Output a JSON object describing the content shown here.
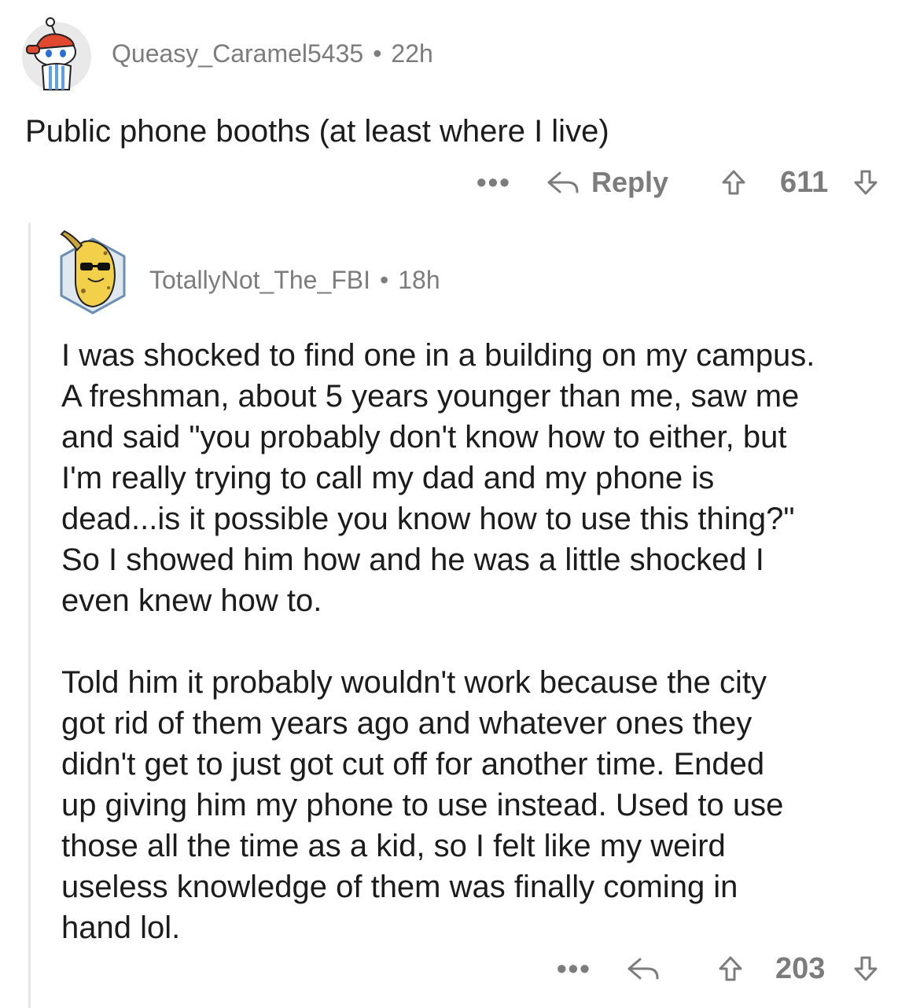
{
  "comment": {
    "username": "Queasy_Caramel5435",
    "separator": "•",
    "age": "22h",
    "text": "Public phone booths (at least where I live)",
    "actions": {
      "more": "•••",
      "reply_label": "Reply",
      "score": "611"
    }
  },
  "reply": {
    "username": "TotallyNot_The_FBI",
    "separator": "•",
    "age": "18h",
    "paragraphs": [
      "I was shocked to find one in a building on my campus.\nA freshman, about 5 years younger than me, saw me\nand said \"you probably don't know how to either, but\nI'm really trying to call my dad and my phone is\ndead...is it possible you know how to use this thing?\"\nSo I showed him how and he was a little shocked I\neven knew how to.",
      "Told him it probably wouldn't work because the city\ngot rid of them years ago and whatever ones they\ndidn't get to just got cut off for another time. Ended\nup giving him my phone to use instead. Used to use\nthose all the time as a kid, so I felt like my weird\nuseless knowledge of them was finally coming in\nhand lol."
    ],
    "actions": {
      "more": "•••",
      "score": "203"
    }
  },
  "icons": {
    "avatar1": "snoo-avatar-icon",
    "avatar2": "banana-avatar-icon",
    "reply": "reply-arrow-icon",
    "upvote": "upvote-arrow-icon",
    "downvote": "downvote-arrow-icon"
  }
}
